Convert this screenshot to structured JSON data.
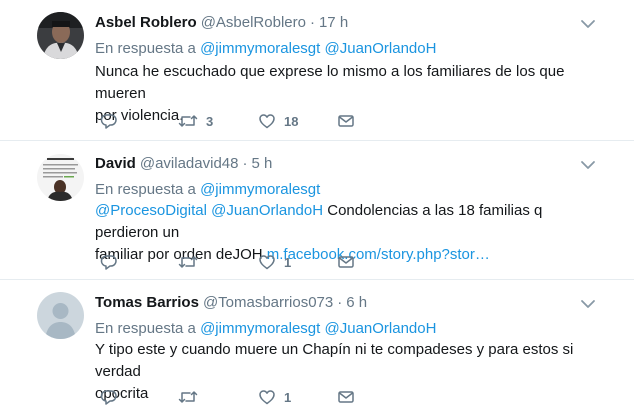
{
  "tweets": [
    {
      "name": "Asbel Roblero",
      "handle": "@AsbelRoblero",
      "dot": "·",
      "time": "17 h",
      "reply_prefix": "En respuesta a",
      "mentions": [
        "@jimmymoralesgt",
        "@JuanOrlandoH"
      ],
      "text_line1": "Nunca he escuchado que exprese lo mismo a los familiares de los que mueren",
      "text_line2": "por violencia.",
      "retweets": "3",
      "likes": "18"
    },
    {
      "name": "David",
      "handle": "@aviladavid48",
      "dot": "·",
      "time": "5 h",
      "reply_prefix": "En respuesta a",
      "mentions": [
        "@jimmymoralesgt"
      ],
      "text_mention1": "@ProcesoDigital",
      "text_mention2": "@JuanOrlandoH",
      "text_part1": "Condolencias a las 18 familias q perdieron un",
      "text_part2": "familiar por orden deJOH",
      "text_link": "m.facebook.com/story.php?stor…",
      "retweets": "",
      "likes": "1"
    },
    {
      "name": "Tomas Barrios",
      "handle": "@Tomasbarrios073",
      "dot": "·",
      "time": "6 h",
      "reply_prefix": "En respuesta a",
      "mentions": [
        "@jimmymoralesgt",
        "@JuanOrlandoH"
      ],
      "text_line1": "Y tipo este y cuando muere un Chapín ni te compadeses y para estos si verdad",
      "text_line2": "opocrita",
      "retweets": "",
      "likes": "1"
    }
  ],
  "icons": {
    "reply": "reply-icon",
    "retweet": "retweet-icon",
    "like": "heart-icon",
    "message": "envelope-icon",
    "caret": "chevron-down-icon"
  },
  "colors": {
    "link": "#1b95e0",
    "secondary": "#657786",
    "divider": "#e6ecf0"
  }
}
